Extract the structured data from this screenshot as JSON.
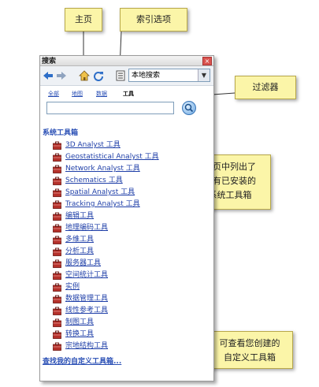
{
  "panel": {
    "title": "搜索",
    "close_label": "×",
    "scope_value": "本地搜索",
    "filters": [
      "全部",
      "地图",
      "数据",
      "工具"
    ],
    "active_filter": "工具",
    "search_value": "",
    "section_title": "系统工具箱",
    "toolboxes": [
      "3D Analyst 工具",
      "Geostatistical Analyst 工具",
      "Network Analyst 工具",
      "Schematics 工具",
      "Spatial Analyst 工具",
      "Tracking Analyst 工具",
      "编辑工具",
      "地理编码工具",
      "多维工具",
      "分析工具",
      "服务器工具",
      "空间统计工具",
      "实例",
      "数据管理工具",
      "线性参考工具",
      "制图工具",
      "转换工具",
      "宗地结构工具"
    ],
    "custom_link": "查找我的自定义工具箱..."
  },
  "callouts": {
    "home": "主页",
    "index_options": "索引选项",
    "filter": "过滤器",
    "home_list": [
      "主页中列出了",
      "所有已安装的",
      "系统工具箱"
    ],
    "custom": [
      "可查看您创建的",
      "自定义工具箱"
    ]
  },
  "colors": {
    "callout_bg": "#fbf5a8",
    "link": "#2a4fb5",
    "toolbox_icon": "#b5302a"
  }
}
